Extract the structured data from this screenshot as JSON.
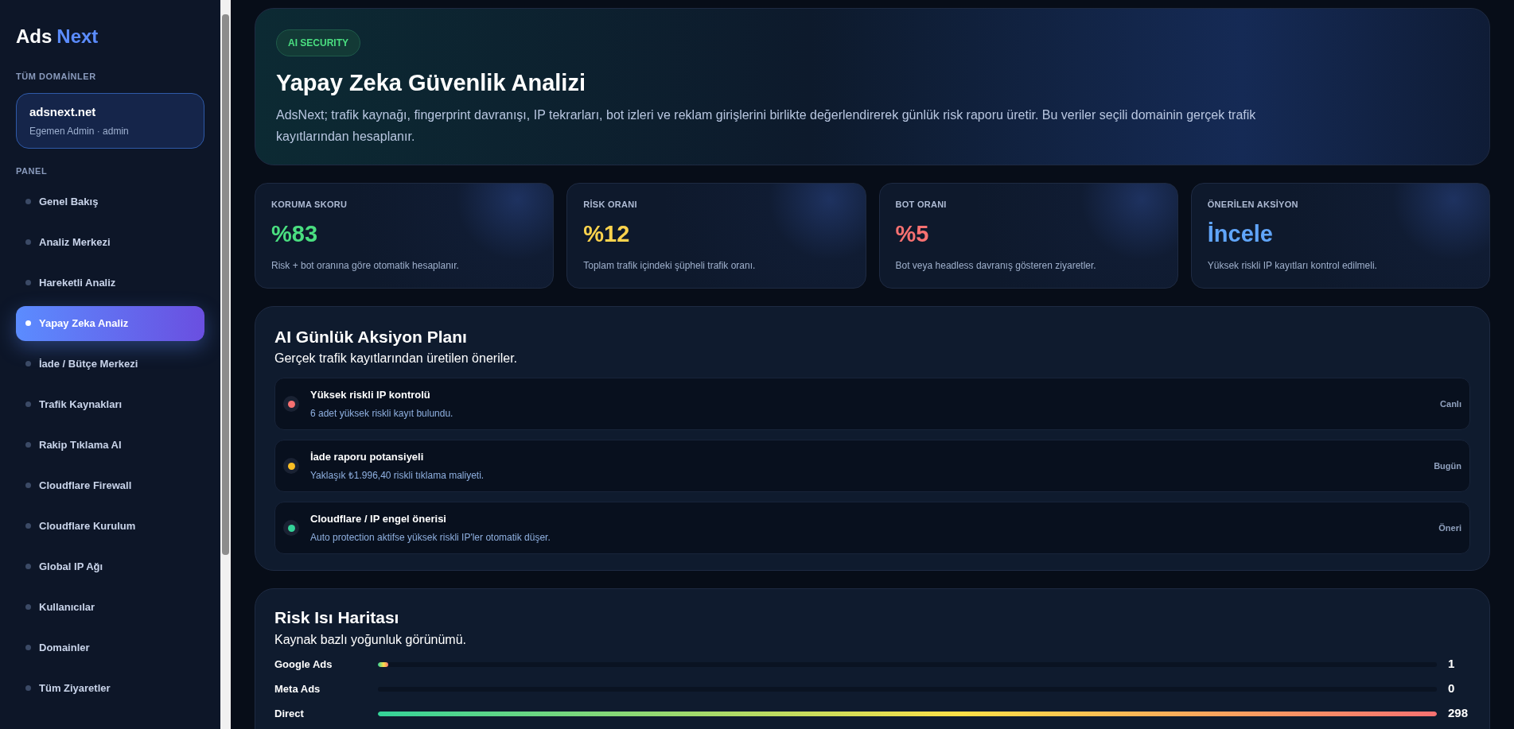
{
  "sidebar": {
    "logo": {
      "part_1": "Ads",
      "part_2": "Next"
    },
    "domains_heading": "TÜM DOMAİNLER",
    "domain": {
      "name": "adsnext.net",
      "user": "Egemen Admin · admin"
    },
    "panel_heading": "PANEL",
    "items": [
      {
        "label": "Genel Bakış",
        "selected": false
      },
      {
        "label": "Analiz Merkezi",
        "selected": false
      },
      {
        "label": "Hareketli Analiz",
        "selected": false
      },
      {
        "label": "Yapay Zeka Analiz",
        "selected": true
      },
      {
        "label": "İade / Bütçe Merkezi",
        "selected": false
      },
      {
        "label": "Trafik Kaynakları",
        "selected": false
      },
      {
        "label": "Rakip Tıklama AI",
        "selected": false
      },
      {
        "label": "Cloudflare Firewall",
        "selected": false
      },
      {
        "label": "Cloudflare Kurulum",
        "selected": false
      },
      {
        "label": "Global IP Ağı",
        "selected": false
      },
      {
        "label": "Kullanıcılar",
        "selected": false
      },
      {
        "label": "Domainler",
        "selected": false
      },
      {
        "label": "Tüm Ziyaretler",
        "selected": false
      }
    ]
  },
  "hero": {
    "badge": "AI SECURITY",
    "title": "Yapay Zeka Güvenlik Analizi",
    "description": "AdsNext; trafik kaynağı, fingerprint davranışı, IP tekrarları, bot izleri ve reklam girişlerini birlikte değerlendirerek günlük risk raporu üretir. Bu veriler seçili domainin gerçek trafik kayıtlarından hesaplanır."
  },
  "stats": [
    {
      "label": "KORUMA SKORU",
      "value": "%83",
      "note": "Risk + bot oranına göre otomatik hesaplanır.",
      "color": "#4ade80"
    },
    {
      "label": "RİSK ORANI",
      "value": "%12",
      "note": "Toplam trafik içindeki şüpheli trafik oranı.",
      "color": "#fcd34d"
    },
    {
      "label": "BOT ORANI",
      "value": "%5",
      "note": "Bot veya headless davranış gösteren ziyaretler.",
      "color": "#f87171"
    },
    {
      "label": "ÖNERİLEN AKSİYON",
      "value": "İncele",
      "note": "Yüksek riskli IP kayıtları kontrol edilmeli.",
      "color": "#60a5fa"
    }
  ],
  "action_plan": {
    "title": "AI Günlük Aksiyon Planı",
    "subtitle": "Gerçek trafik kayıtlarından üretilen öneriler.",
    "items": [
      {
        "title": "Yüksek riskli IP kontrolü",
        "detail": "6 adet yüksek riskli kayıt bulundu.",
        "tag": "Canlı",
        "color": "#f87171"
      },
      {
        "title": "İade raporu potansiyeli",
        "detail": "Yaklaşık ₺1.996,40 riskli tıklama maliyeti.",
        "tag": "Bugün",
        "color": "#fbbf24"
      },
      {
        "title": "Cloudflare / IP engel önerisi",
        "detail": "Auto protection aktifse yüksek riskli IP'ler otomatik düşer.",
        "tag": "Öneri",
        "color": "#34d399"
      }
    ]
  },
  "heatmap": {
    "title": "Risk Isı Haritası",
    "subtitle": "Kaynak bazlı yoğunluk görünümü.",
    "rows": [
      {
        "label": "Google Ads",
        "level": 0.01,
        "count": "1"
      },
      {
        "label": "Meta Ads",
        "count": "0"
      },
      {
        "label": "Direct",
        "level": 1,
        "count": "298"
      }
    ]
  }
}
